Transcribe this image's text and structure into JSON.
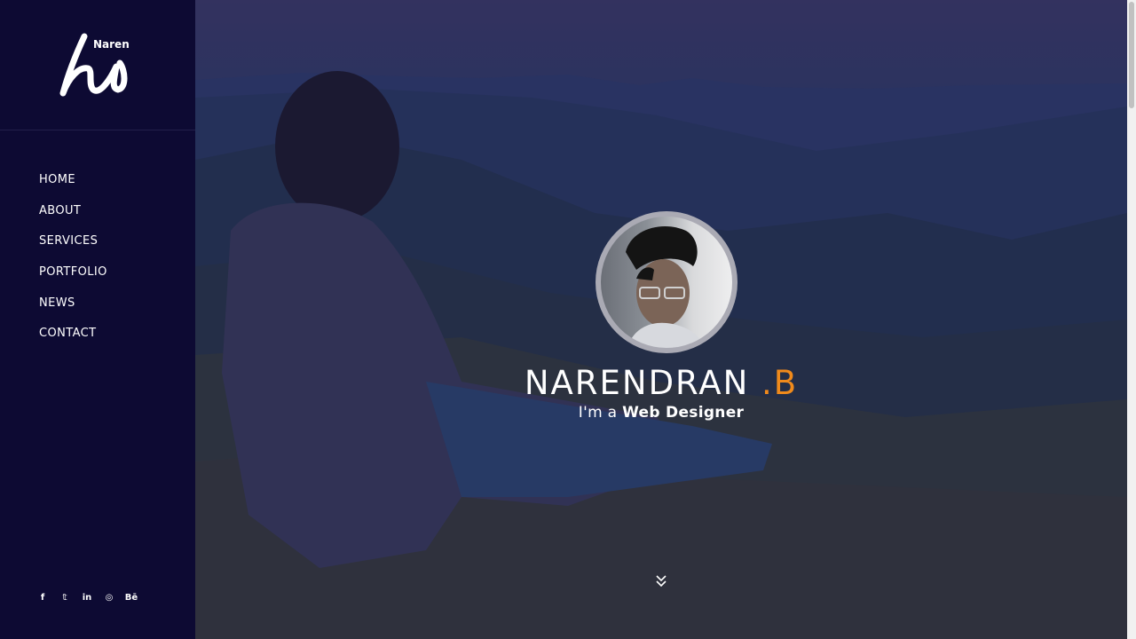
{
  "brand": {
    "logo_text": "Naren"
  },
  "nav": {
    "items": [
      {
        "label": "HOME"
      },
      {
        "label": "ABOUT"
      },
      {
        "label": "SERVICES"
      },
      {
        "label": "PORTFOLIO"
      },
      {
        "label": "NEWS"
      },
      {
        "label": "CONTACT"
      }
    ]
  },
  "sidebar": {
    "toggle_glyph": "‹"
  },
  "socials": [
    {
      "icon": "facebook-icon",
      "glyph": "f"
    },
    {
      "icon": "twitter-icon",
      "glyph": "𝕥"
    },
    {
      "icon": "linkedin-icon",
      "glyph": "in"
    },
    {
      "icon": "instagram-icon",
      "glyph": "◎"
    },
    {
      "icon": "behance-icon",
      "glyph": "Bē"
    }
  ],
  "hero": {
    "name_main": "NARENDRAN",
    "name_accent": ".B",
    "tagline_prefix": "I'm a",
    "tagline_role": "Web Designer",
    "scroll_icon": "double-chevron-down-icon"
  },
  "colors": {
    "sidebar_bg": "#0d0a33",
    "accent": "#f08a1b",
    "text": "#ffffff"
  }
}
